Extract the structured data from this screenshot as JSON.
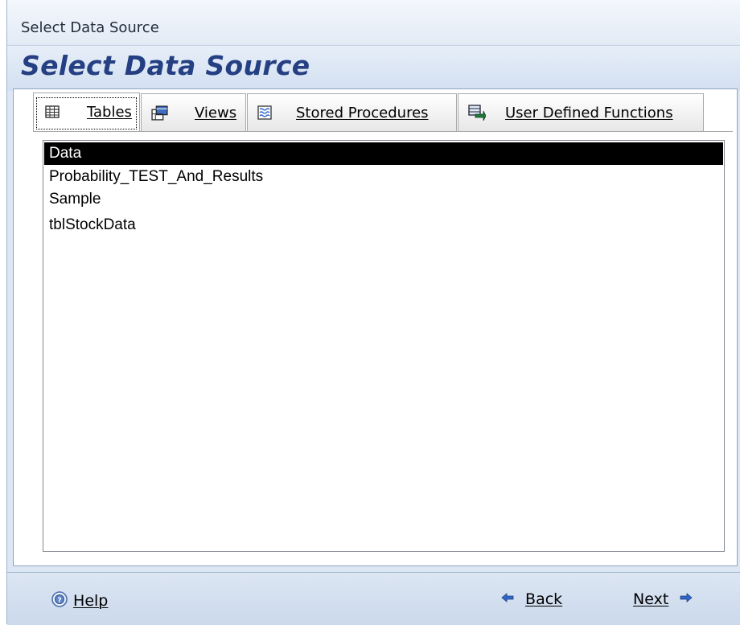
{
  "window": {
    "title": "Select Data Source"
  },
  "header": {
    "title": "Select Data Source"
  },
  "tabs": [
    {
      "label": "Tables",
      "icon": "table-icon",
      "active": true
    },
    {
      "label": "Views",
      "icon": "view-icon",
      "active": false
    },
    {
      "label": "Stored Procedures",
      "icon": "stored-procedure-icon",
      "active": false
    },
    {
      "label": "User Defined Functions",
      "icon": "function-icon",
      "active": false
    }
  ],
  "list": {
    "items": [
      "Data",
      "Probability_TEST_And_Results",
      "Sample",
      "tblStockData"
    ],
    "selected_index": 0
  },
  "footer": {
    "help_label": "Help",
    "back_label": "Back",
    "next_label": "Next"
  },
  "colors": {
    "header_title": "#243f82",
    "selection": "#000000",
    "footer_bg": "#cbd9ec"
  }
}
